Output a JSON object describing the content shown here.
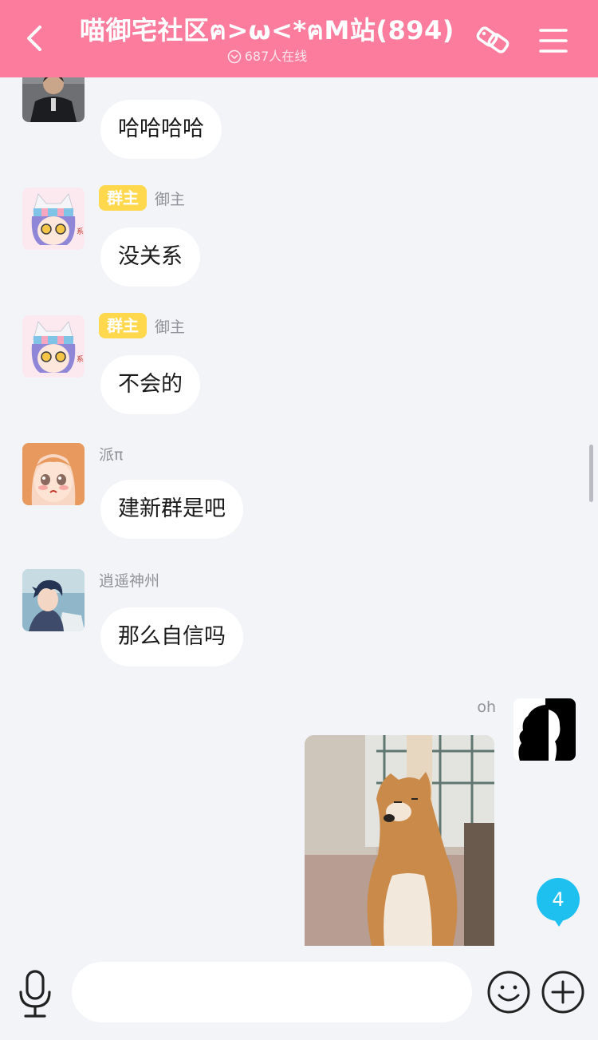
{
  "header": {
    "title": "喵御宅社区ฅ>ω<*ฅM站(894)",
    "online_count": "687人在线",
    "icons": [
      "back-arrow",
      "link-icon",
      "menu-icon",
      "chevron-down-icon"
    ]
  },
  "messages": [
    {
      "text": "哈哈哈哈",
      "avatar": "man-in-suit-photo"
    },
    {
      "badge": "群主",
      "sender": "御主",
      "text": "没关系",
      "avatar": "anime-cat-hat-girl"
    },
    {
      "badge": "群主",
      "sender": "御主",
      "text": "不会的",
      "avatar": "anime-cat-hat-girl"
    },
    {
      "sender": "派π",
      "text": "建新群是吧",
      "avatar": "anime-orange-hair-girl"
    },
    {
      "sender": "逍遥神州",
      "text": "那么自信吗",
      "avatar": "anime-blue-hair-boy"
    }
  ],
  "my_message": {
    "sender": "oh",
    "image": "shiba-dog-sitting",
    "avatar": "black-white-silhouette"
  },
  "unread_count": "4",
  "input": {
    "value": "",
    "placeholder": ""
  },
  "colors": {
    "header": "#fb7c9d",
    "badge": "#ffd84d",
    "unread": "#1ec0f0",
    "background": "#f2f4f8"
  }
}
